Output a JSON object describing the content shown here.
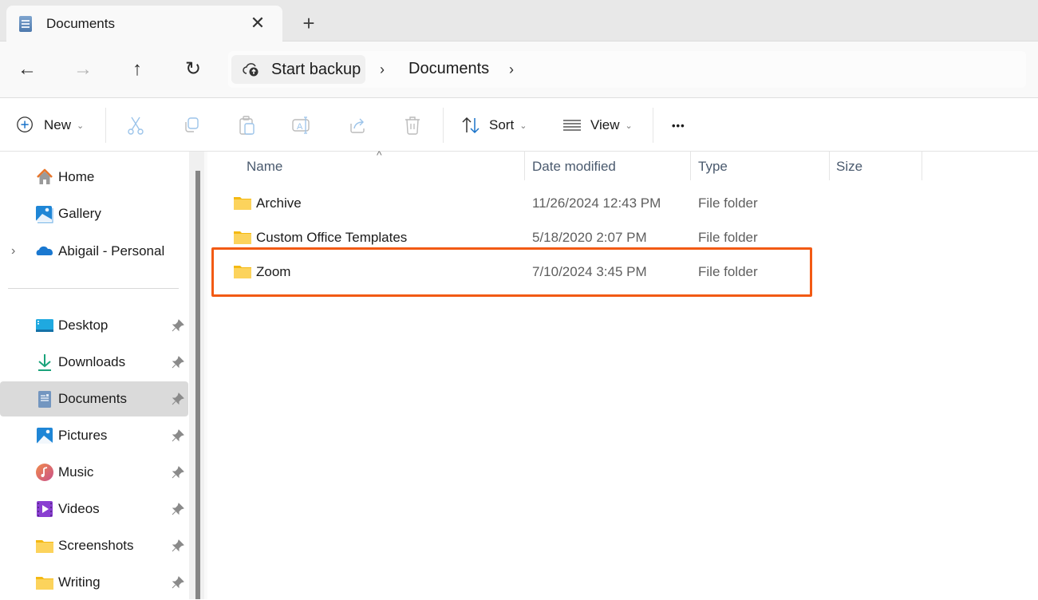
{
  "window": {
    "tab_title": "Documents",
    "tab_icon": "documents-icon",
    "close_tab_symbol": "✕",
    "new_tab_symbol": "+"
  },
  "navigation": {
    "back_symbol": "←",
    "forward_symbol": "→",
    "up_symbol": "↑",
    "refresh_symbol": "↻"
  },
  "address_bar": {
    "backup_label": "Start backup",
    "breadcrumb": [
      "Documents"
    ],
    "separator": "›"
  },
  "command_bar": {
    "new_label": "New",
    "sort_label": "Sort",
    "view_label": "View",
    "more_symbol": "•••",
    "chevron": "⌄",
    "disabled_actions": [
      "cut",
      "copy",
      "paste",
      "rename",
      "share",
      "delete"
    ]
  },
  "sidebar": {
    "top_items": [
      {
        "label": "Home",
        "icon": "home-icon"
      },
      {
        "label": "Gallery",
        "icon": "gallery-icon"
      },
      {
        "label": "Abigail - Personal",
        "icon": "onedrive-cloud-icon",
        "expandable": true
      }
    ],
    "pinned_items": [
      {
        "label": "Desktop",
        "icon": "desktop-icon",
        "pinned": true
      },
      {
        "label": "Downloads",
        "icon": "downloads-icon",
        "pinned": true
      },
      {
        "label": "Documents",
        "icon": "documents-icon",
        "pinned": true,
        "selected": true
      },
      {
        "label": "Pictures",
        "icon": "pictures-icon",
        "pinned": true
      },
      {
        "label": "Music",
        "icon": "music-icon",
        "pinned": true
      },
      {
        "label": "Videos",
        "icon": "videos-icon",
        "pinned": true
      },
      {
        "label": "Screenshots",
        "icon": "folder-icon",
        "pinned": true
      },
      {
        "label": "Writing",
        "icon": "folder-icon",
        "pinned": true
      }
    ],
    "expander_symbol": "›"
  },
  "file_list": {
    "columns": [
      "Name",
      "Date modified",
      "Type",
      "Size"
    ],
    "sort_indicator": "^",
    "rows": [
      {
        "name": "Archive",
        "date": "11/26/2024 12:43 PM",
        "type": "File folder",
        "size": ""
      },
      {
        "name": "Custom Office Templates",
        "date": "5/18/2020 2:07 PM",
        "type": "File folder",
        "size": ""
      },
      {
        "name": "Zoom",
        "date": "7/10/2024 3:45 PM",
        "type": "File folder",
        "size": "",
        "highlighted": true
      }
    ],
    "highlight_color": "#f25a14"
  }
}
